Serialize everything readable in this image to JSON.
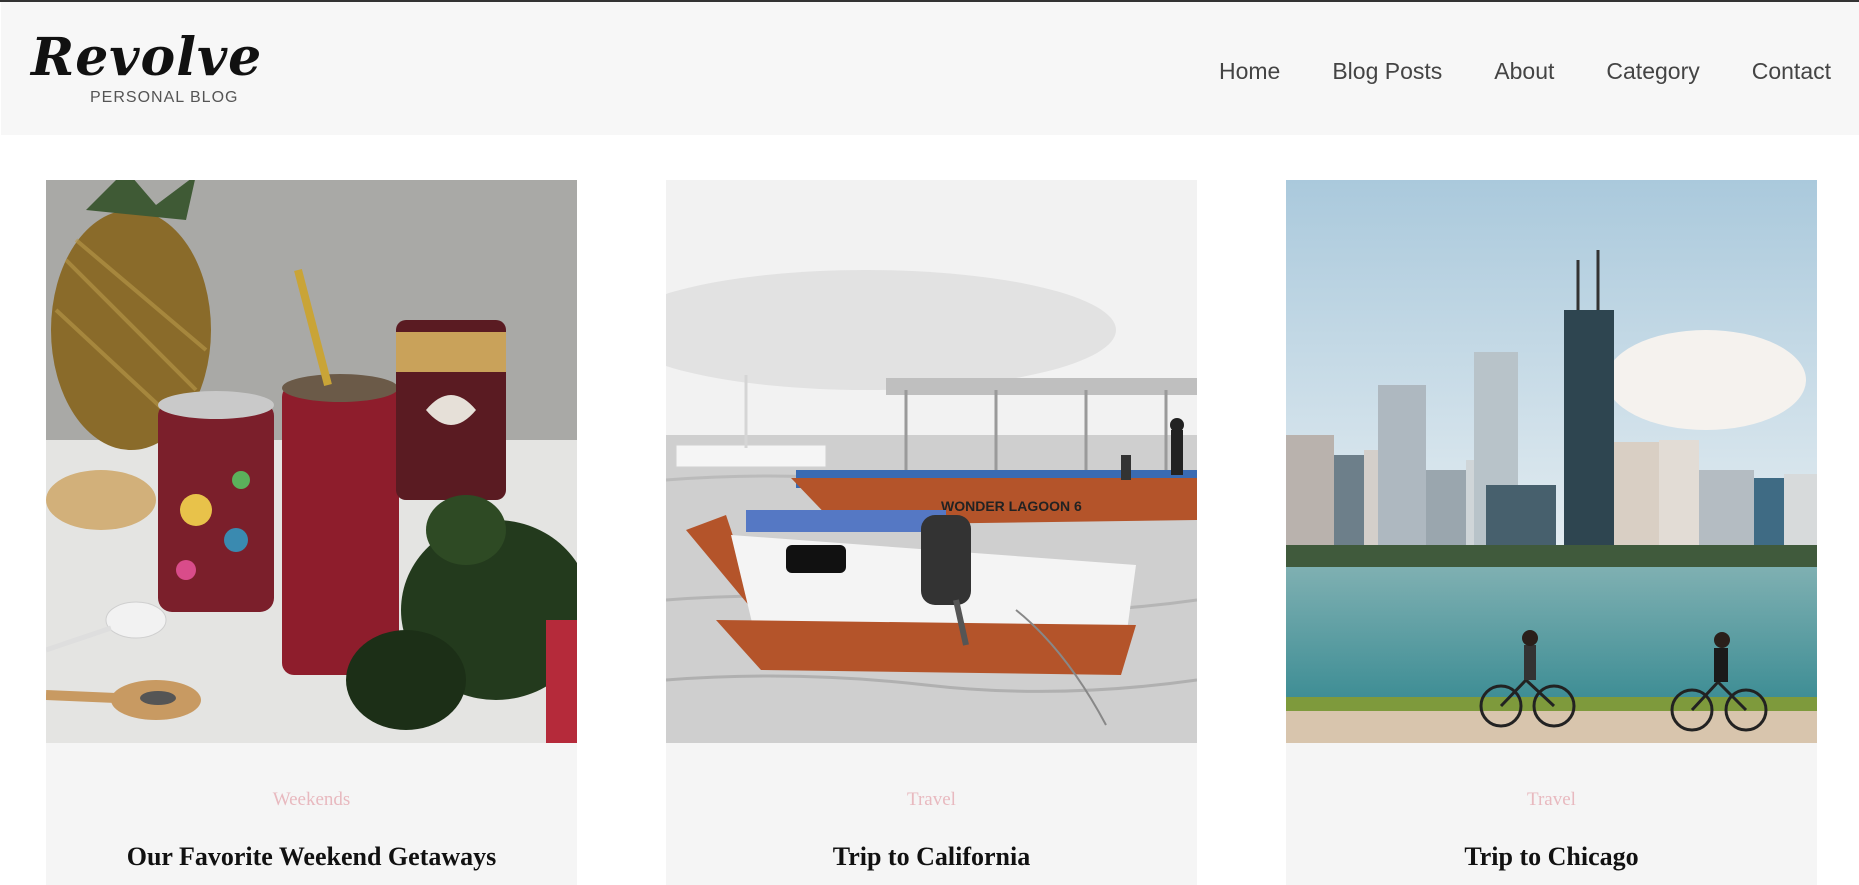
{
  "brand": {
    "logo_script": "Revolve",
    "logo_sub": "PERSONAL BLOG"
  },
  "nav": {
    "items": [
      {
        "label": "Home"
      },
      {
        "label": "Blog Posts"
      },
      {
        "label": "About"
      },
      {
        "label": "Category"
      },
      {
        "label": "Contact"
      }
    ]
  },
  "posts": [
    {
      "category": "Weekends",
      "title": "Our Favorite Weekend Getaways",
      "image": "smoothie-drinks-photo"
    },
    {
      "category": "Travel",
      "title": "Trip to California",
      "image": "boats-lagoon-photo",
      "boat_label": "WONDER LAGOON 6"
    },
    {
      "category": "Travel",
      "title": "Trip to Chicago",
      "image": "chicago-skyline-photo"
    }
  ],
  "colors": {
    "header_bg": "#f7f7f7",
    "card_bg": "#f5f5f5",
    "category_pink": "#e8b9bf",
    "title": "#111111",
    "nav_text": "#444444"
  }
}
